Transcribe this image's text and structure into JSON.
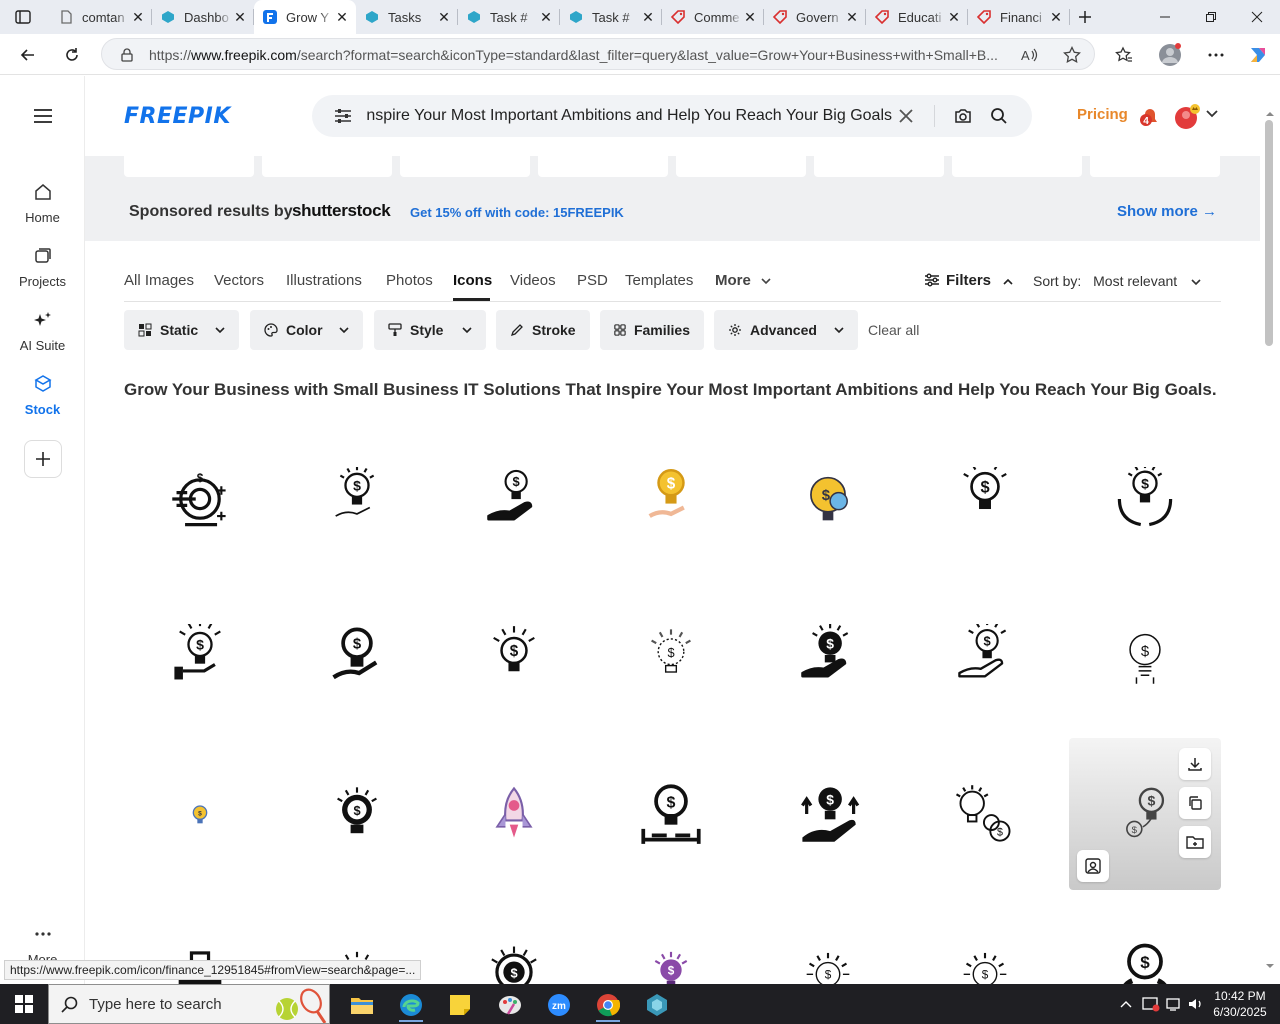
{
  "browser": {
    "tabs": [
      {
        "title": "comtan",
        "favicon": "document-icon",
        "color": "#6b6b6b",
        "active": false
      },
      {
        "title": "Dashbo",
        "favicon": "hexagon-icon",
        "color": "#2ea6c9",
        "active": false
      },
      {
        "title": "Grow Y",
        "favicon": "freepik-icon",
        "color": "#1273eb",
        "active": true
      },
      {
        "title": "Tasks",
        "favicon": "hexagon-icon",
        "color": "#2ea6c9",
        "active": false
      },
      {
        "title": "Task #",
        "favicon": "hexagon-icon",
        "color": "#2ea6c9",
        "active": false
      },
      {
        "title": "Task #",
        "favicon": "hexagon-icon",
        "color": "#2ea6c9",
        "active": false
      },
      {
        "title": "Comme",
        "favicon": "tag-icon",
        "color": "#d93030",
        "active": false
      },
      {
        "title": "Govern",
        "favicon": "tag-icon",
        "color": "#d93030",
        "active": false
      },
      {
        "title": "Educati",
        "favicon": "tag-icon",
        "color": "#d93030",
        "active": false
      },
      {
        "title": "Financi",
        "favicon": "tag-icon",
        "color": "#d93030",
        "active": false
      }
    ],
    "url_prefix": "https://",
    "url_host": "www.freepik.com",
    "url_rest": "/search?format=search&iconType=standard&last_filter=query&last_value=Grow+Your+Business+with+Small+B..."
  },
  "rail": {
    "items": [
      {
        "label": "Home",
        "icon": "home-icon"
      },
      {
        "label": "Projects",
        "icon": "projects-icon"
      },
      {
        "label": "AI Suite",
        "icon": "sparkle-icon"
      },
      {
        "label": "Stock",
        "icon": "stock-icon",
        "active": true
      }
    ],
    "more_label": "More"
  },
  "header": {
    "logo": "FREEPIK",
    "search_value": "Grow Your Business with Small Business IT Solutions That Inspire Your Most Important Ambitions and Help You Reach Your Big Goals.",
    "pricing_label": "Pricing",
    "notification_count": "4"
  },
  "sponsored": {
    "label": "Sponsored results by",
    "brand": "shutterstock",
    "promo": "Get 15% off with code: 15FREEPIK",
    "show_more": "Show more →"
  },
  "categories": [
    "All Images",
    "Vectors",
    "Illustrations",
    "Photos",
    "Icons",
    "Videos",
    "PSD",
    "Templates",
    "More"
  ],
  "active_category": "Icons",
  "filters_label": "Filters",
  "sort": {
    "label": "Sort by:",
    "value": "Most relevant"
  },
  "filter_pills": [
    {
      "label": "Static",
      "icon": "static-icon",
      "dropdown": true
    },
    {
      "label": "Color",
      "icon": "palette-icon",
      "dropdown": true
    },
    {
      "label": "Style",
      "icon": "brush-icon",
      "dropdown": true
    },
    {
      "label": "Stroke",
      "icon": "pen-icon",
      "dropdown": false
    },
    {
      "label": "Families",
      "icon": "grid-icon",
      "dropdown": false
    },
    {
      "label": "Advanced",
      "icon": "gear-icon",
      "dropdown": true
    }
  ],
  "clear_all": "Clear all",
  "results_title": "Grow Your Business with Small Business IT Solutions That Inspire Your Most Important Ambitions and Help You Reach Your Big Goals.",
  "results": [
    [
      "target-coin-icon",
      "bulb-hand-outline-icon",
      "bulb-hand-solid-icon",
      "bulb-hand-color-icon",
      "bulb-gear-color-icon",
      "bulb-dollar-outline-icon",
      "hands-bulb-icon"
    ],
    [
      "bulb-rays-hand-icon",
      "bulb-hand-bold-icon",
      "bulb-rays-outline-icon",
      "bulb-dashed-icon",
      "bulb-hand-black-icon",
      "bulb-rays-hand-outline-icon",
      "bulb-dollar-thin-icon"
    ],
    [
      "bulb-color-small-icon",
      "bulb-gear-solid-icon",
      "rocket-bulb-icon",
      "bulb-stand-icon",
      "bulb-hand-arrows-icon",
      "bulb-coins-icon",
      "bulb-coin-hover-icon"
    ],
    [
      "briefcase-icon",
      "bulb-partial-icon",
      "coin-rays-icon",
      "bulb-purple-icon",
      "bulb-dashed-2-icon",
      "bulb-dashed-3-icon",
      "hands-dollar-icon"
    ]
  ],
  "hover_actions": [
    "download-icon",
    "copy-icon",
    "folder-add-icon",
    "similar-image-icon"
  ],
  "status_url": "https://www.freepik.com/icon/finance_12951845#fromView=search&page=...",
  "taskbar": {
    "search_placeholder": "Type here to search",
    "apps": [
      "file-explorer-icon",
      "edge-icon",
      "sticky-notes-icon",
      "paint-icon",
      "zoom-icon",
      "chrome-icon",
      "app-icon"
    ],
    "time": "10:42 PM",
    "date": "6/30/2025"
  },
  "colors": {
    "brand": "#1273eb",
    "pricing": "#e8882b",
    "promo": "#1f6fd6"
  }
}
